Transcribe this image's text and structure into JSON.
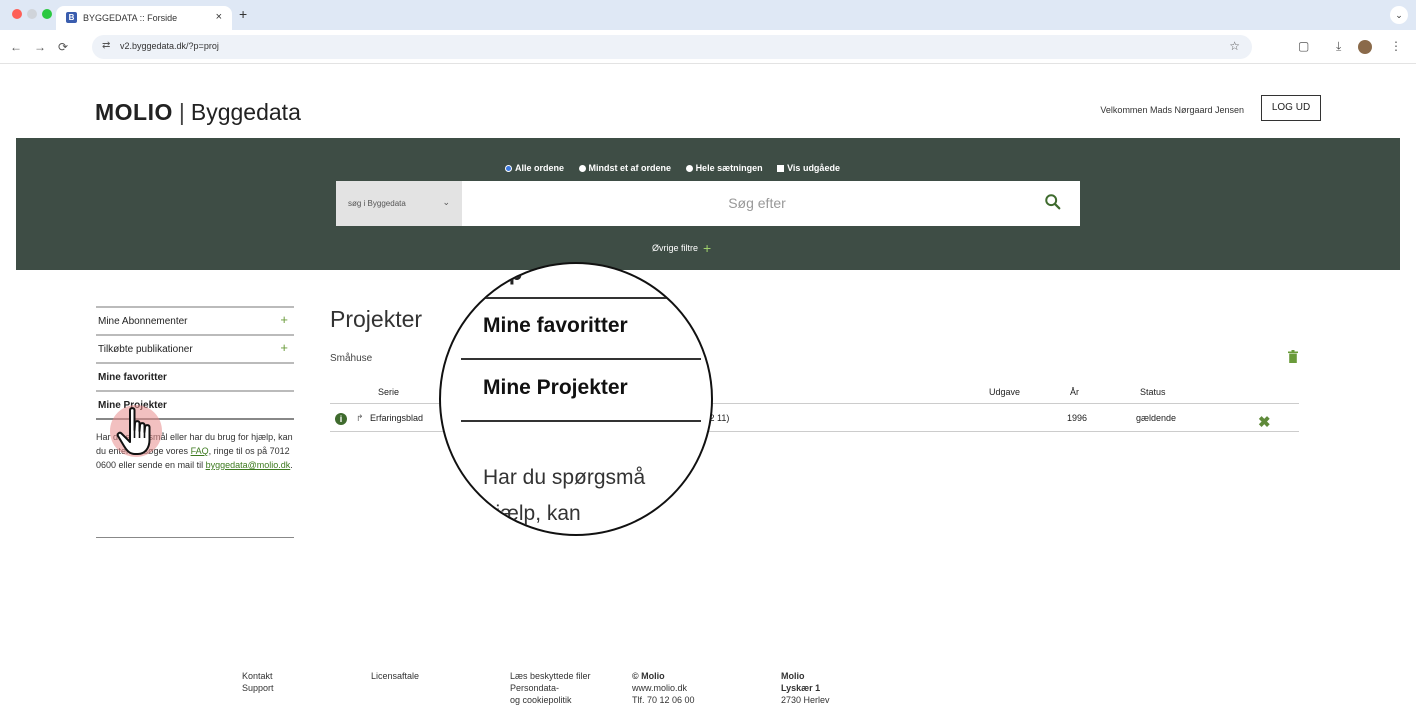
{
  "browser": {
    "tab_title": "BYGGEDATA :: Forside",
    "tab_close": "×",
    "new_tab": "+",
    "tab_menu": "⌄",
    "back": "←",
    "forward": "→",
    "reload": "⟳",
    "url": "v2.byggedata.dk/?p=proj",
    "star": "☆",
    "toolbar_icons": [
      "▢",
      "⤓",
      "⋮"
    ]
  },
  "header": {
    "logo_brand": "MOLIO",
    "logo_sep": "|",
    "logo_product": "Byggedata",
    "welcome": "Velkommen Mads Nørgaard Jensen",
    "logout_label": "LOG UD"
  },
  "search": {
    "radio_options": [
      "Alle ordene",
      "Mindst et af ordene",
      "Hele sætningen"
    ],
    "checkbox_label": "Vis udgåede",
    "scope_label": "søg i Byggedata",
    "scope_chevron": "⌄",
    "placeholder": "Søg efter",
    "filters_label": "Øvrige filtre",
    "filters_plus": "+"
  },
  "sidebar": {
    "items": [
      {
        "label": "Mine Abonnementer",
        "plus": "+"
      },
      {
        "label": "Tilkøbte publikationer",
        "plus": "+"
      },
      {
        "label": "Mine favoritter",
        "plus": ""
      },
      {
        "label": "Mine Projekter",
        "plus": ""
      }
    ],
    "help_text_1": "Har du spørgsmål eller har du brug for hjælp, kan du enten besøge vores ",
    "help_link_faq": "FAQ",
    "help_text_2": ", ringe til os på 7012 0600 eller sende en mail til ",
    "help_link_mail": "byggedata@molio.dk",
    "help_text_3": "."
  },
  "main": {
    "title": "Projekter",
    "subtitle": "Småhuse",
    "columns": {
      "serie": "Serie",
      "udgave": "Udgave",
      "aar": "År",
      "status": "Status"
    },
    "rows": [
      {
        "info": "i",
        "arrow": "↱",
        "serie": "Erfaringsblad",
        "title_tail": "(5 12 11)",
        "udgave": "",
        "aar": "1996",
        "status": "gældende",
        "delete": "✖"
      }
    ]
  },
  "magnifier": {
    "top_fragment": "ste p",
    "favorites": "Mine favoritter",
    "projects": "Mine Projekter",
    "help_line1": "Har du spørgsmå",
    "help_line2": "r hjælp, kan"
  },
  "footer": {
    "col1": [
      "Kontakt",
      "Support"
    ],
    "col2": [
      "Licensaftale"
    ],
    "col3": [
      "Læs beskyttede filer",
      "Persondata-",
      "og cookiepolitik"
    ],
    "col4": [
      "© Molio",
      "www.molio.dk",
      "Tlf. 70 12 06 00"
    ],
    "col5": [
      "Molio",
      "Lyskær 1",
      "2730 Herlev"
    ]
  },
  "colors": {
    "band": "#3e4d45",
    "accent_green": "#6a9b3a",
    "link_green": "#3d7a1f",
    "tab_bar": "#dfe8f5"
  }
}
